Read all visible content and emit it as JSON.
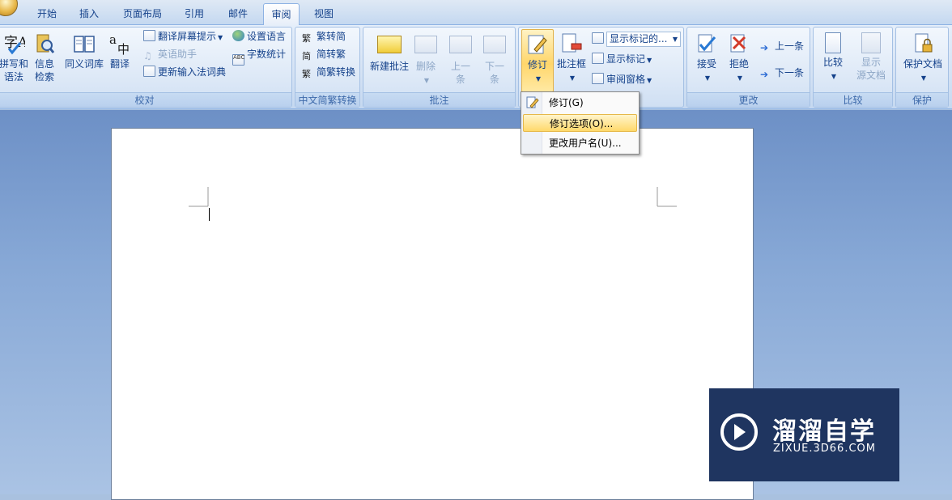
{
  "tabs": [
    "开始",
    "插入",
    "页面布局",
    "引用",
    "邮件",
    "审阅",
    "视图"
  ],
  "active_tab": "审阅",
  "groups": {
    "proofing": {
      "label": "校对",
      "spelling": "拼写和\n语法",
      "research": "信息\n检索",
      "thesaurus": "同义词库",
      "translate": "翻译",
      "translate_tip": "翻译屏幕提示",
      "english_helper": "英语助手",
      "update_ime": "更新输入法词典",
      "set_language": "设置语言",
      "word_count": "字数统计"
    },
    "chinese_conversion": {
      "label": "中文简繁转换",
      "t2s": "繁转简",
      "s2t": "简转繁",
      "convert": "简繁转换"
    },
    "comments": {
      "label": "批注",
      "new_comment": "新建批注",
      "delete": "删除",
      "previous": "上一\n条",
      "next": "下一\n条"
    },
    "tracking": {
      "track_changes": "修订",
      "balloons": "批注框",
      "display_combo": "显示标记的...",
      "show_markup": "显示标记",
      "reviewing_pane": "审阅窗格"
    },
    "changes": {
      "label": "更改",
      "accept": "接受",
      "reject": "拒绝",
      "previous": "上一条",
      "next": "下一条"
    },
    "compare": {
      "label": "比较",
      "compare": "比较",
      "show_source": "显示\n源文档"
    },
    "protect": {
      "label": "保护",
      "protect_doc": "保护文档"
    }
  },
  "dropdown": {
    "items": [
      "修订(G)",
      "修订选项(O)...",
      "更改用户名(U)..."
    ],
    "highlighted_index": 1
  },
  "watermark": {
    "brand": "溜溜自学",
    "url": "ZIXUE.3D66.COM"
  }
}
